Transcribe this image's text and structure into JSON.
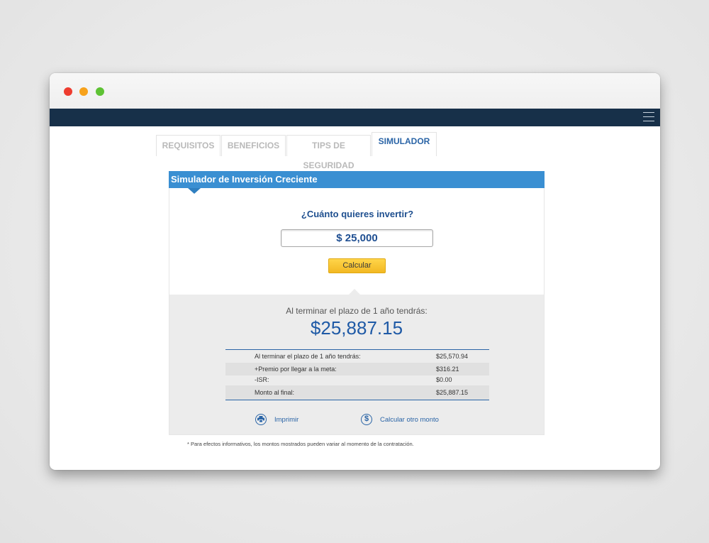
{
  "tabs": [
    {
      "label": "REQUISITOS"
    },
    {
      "label": "BENEFICIOS"
    },
    {
      "label": "TIPS DE SEGURIDAD"
    },
    {
      "label": "SIMULADOR",
      "active": true
    }
  ],
  "simulator": {
    "header": "Simulador de Inversión Creciente",
    "question": "¿Cuánto quieres invertir?",
    "amount_value": "$ 25,000",
    "calculate_label": "Calcular"
  },
  "results": {
    "caption": "Al terminar el plazo de 1 año tendrás:",
    "total": "$25,887.15",
    "rows": [
      {
        "label": "Al terminar el plazo de 1 año tendrás:",
        "value": "$25,570.94"
      },
      {
        "label": "+Premio por llegar a la meta:",
        "value": "$316.21"
      },
      {
        "label": "-ISR:",
        "value": "$0.00"
      },
      {
        "label": "Monto al final:",
        "value": "$25,887.15"
      }
    ],
    "print_label": "Imprimir",
    "recalc_label": "Calcular otro monto"
  },
  "footnote": "* Para efectos informativos, los montos mostrados pueden variar al momento de la contratación.",
  "icons": {
    "print": "printer-icon",
    "recalc": "dollar-icon",
    "menu": "hamburger-icon"
  },
  "colors": {
    "navbar": "#173049",
    "header_blue": "#3a8fd2",
    "accent_blue": "#2a64a6",
    "button_yellow": "#f2b822"
  }
}
